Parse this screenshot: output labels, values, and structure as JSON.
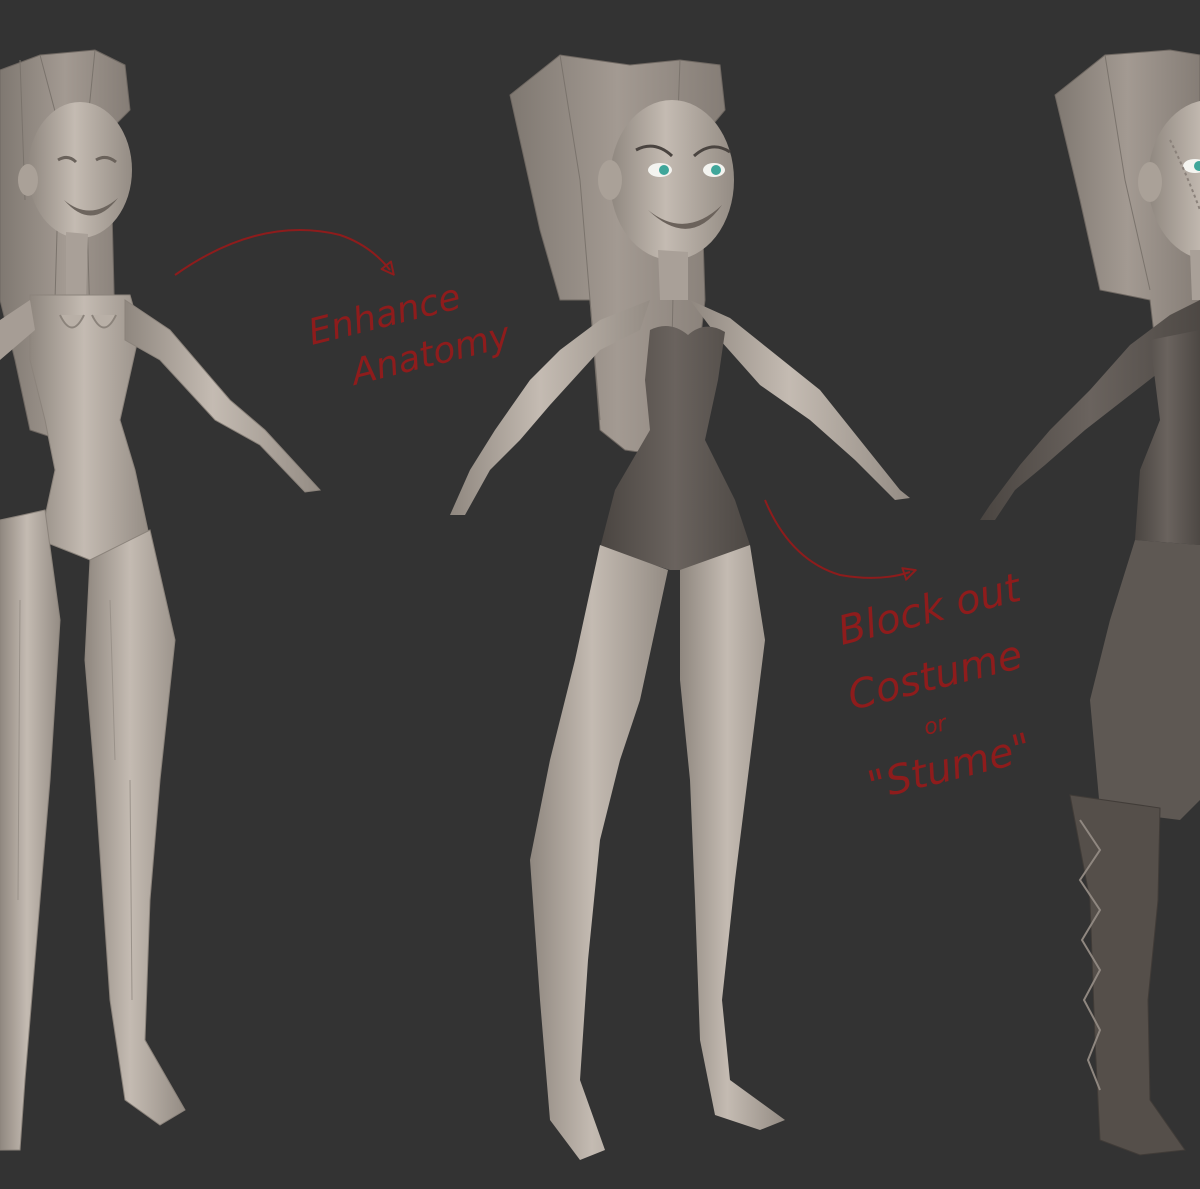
{
  "canvas": {
    "background": "#333333"
  },
  "colors": {
    "clay": "#b3aaa1",
    "clay_light": "#c9c1b8",
    "clay_shadow": "#8f877f",
    "costume": "#5a544f",
    "costume_light": "#6d6661",
    "boot": "#544e49",
    "ink": "#8e1c1c",
    "iris": "#3fa69a"
  },
  "figures": [
    {
      "stage": "low-poly-blockout"
    },
    {
      "stage": "refined-anatomy"
    },
    {
      "stage": "costume-blockout"
    }
  ],
  "annotations": {
    "note1": {
      "line1": "Enhance",
      "line2": "Anatomy"
    },
    "note2": {
      "line1": "Block out",
      "line2": "Costume",
      "line3": "or",
      "line4": "\"Stume\""
    }
  }
}
